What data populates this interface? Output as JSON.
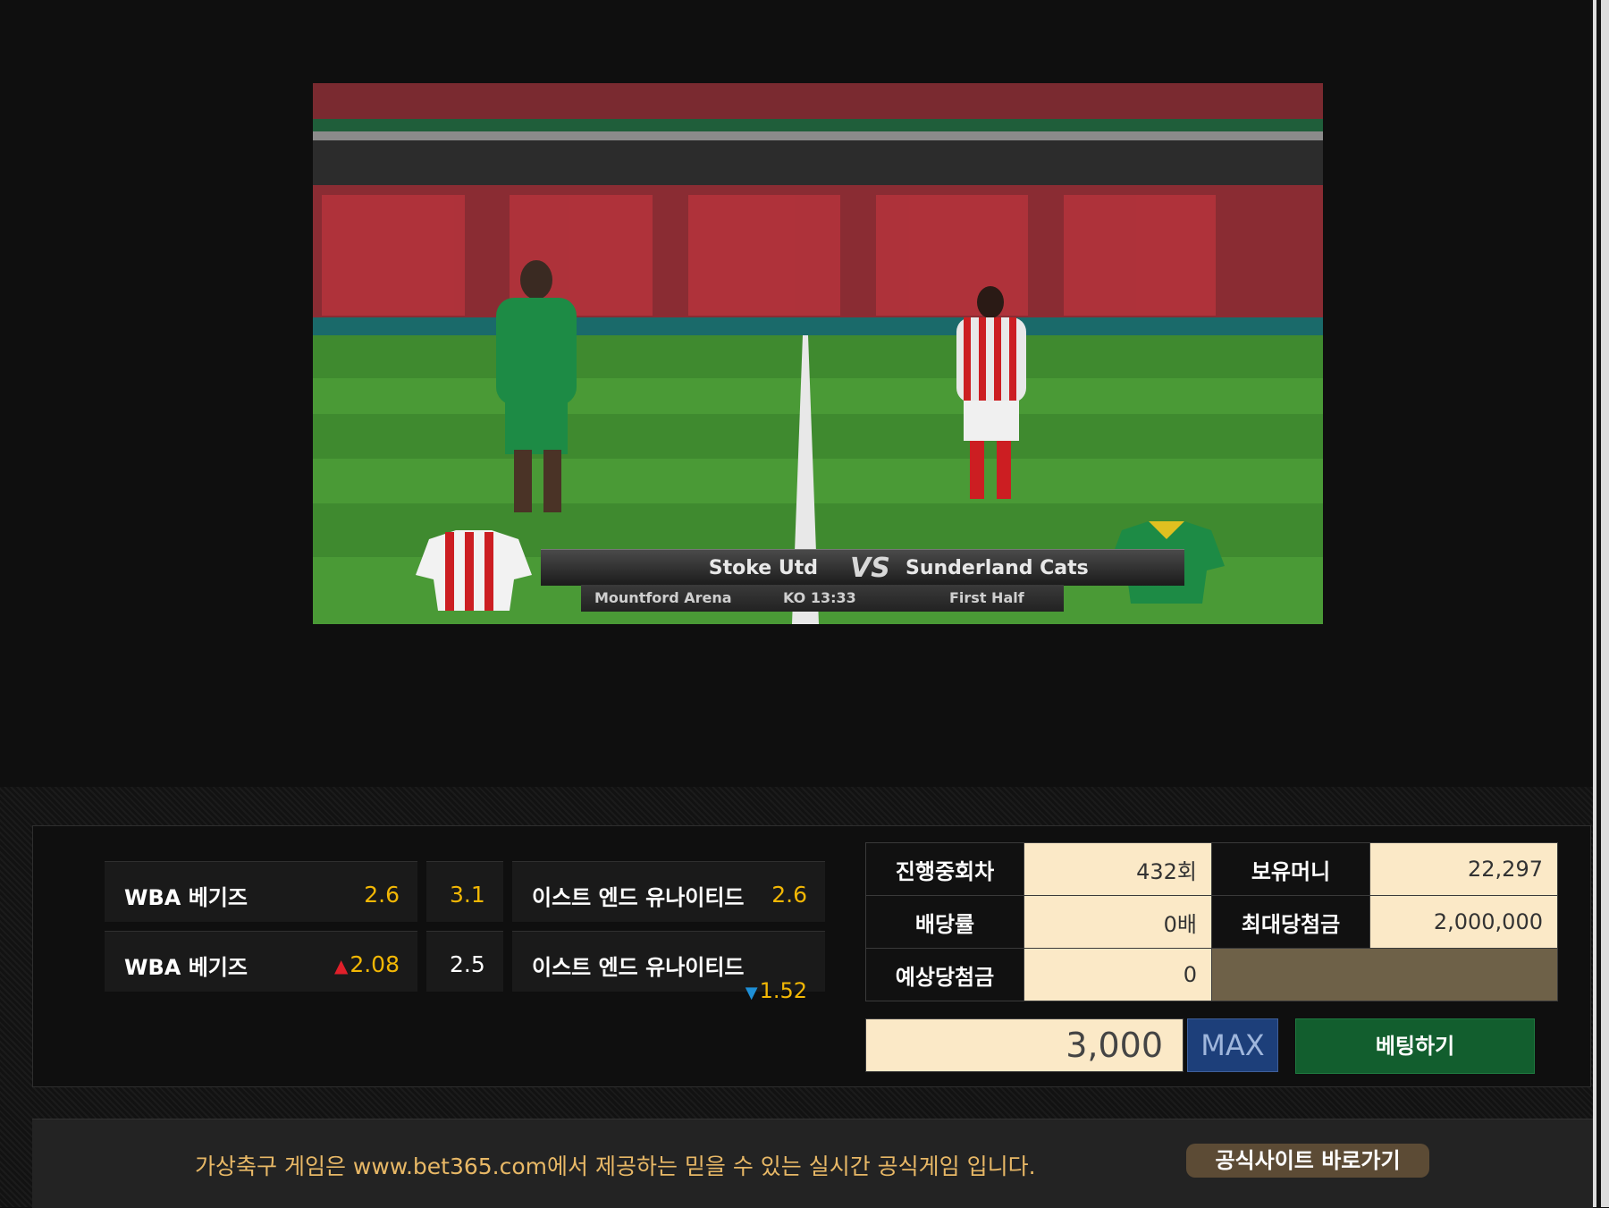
{
  "video": {
    "home_team": "Stoke Utd",
    "vs": "VS",
    "away_team": "Sunderland Cats",
    "venue": "Mountford Arena",
    "kickoff": "KO 13:33",
    "period": "First Half",
    "home_shirt_icon": "striped-shirt-icon",
    "away_shirt_icon": "green-shirt-icon",
    "colors": {
      "home": "#cc1e22",
      "away": "#1d8b45",
      "pitch": "#3f8a2f"
    }
  },
  "odds": [
    {
      "home": "WBA 베기즈",
      "home_odd": "2.6",
      "draw": "3.1",
      "away": "이스트 엔드 유나이티드",
      "away_odd": "2.6"
    },
    {
      "home": "WBA 베기즈",
      "home_odd": "2.08",
      "home_trend": "▲",
      "draw": "2.5",
      "away": "이스트 엔드 유나이티드",
      "away_odd": "1.52",
      "away_trend": "▼"
    }
  ],
  "info": {
    "round_label": "진행중회차",
    "round_value": "432회",
    "money_label": "보유머니",
    "money_value": "22,297",
    "rate_label": "배당률",
    "rate_value": "0배",
    "maxwin_label": "최대당첨금",
    "maxwin_value": "2,000,000",
    "expected_label": "예상당첨금",
    "expected_value": "0"
  },
  "bet": {
    "amount": "3,000",
    "max_label": "MAX",
    "submit_label": "베팅하기"
  },
  "footer": {
    "text": "가상축구 게임은 www.bet365.com에서 제공하는 믿을 수 있는 실시간 공식게임 입니다.",
    "button_label": "공식사이트 바로가기"
  },
  "colors": {
    "accent_odd": "#f2b705",
    "bet_button": "#125e2e",
    "max_button": "#1d3f7a",
    "value_bg": "#fbe9c7"
  }
}
